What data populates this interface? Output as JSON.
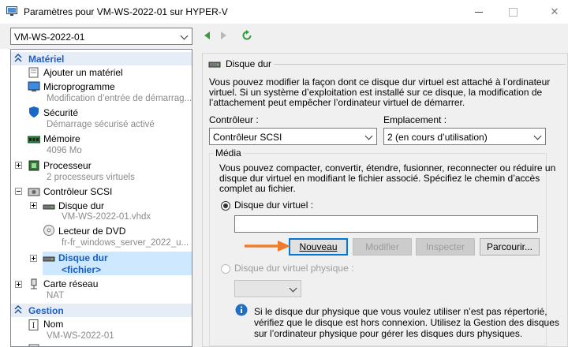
{
  "window": {
    "title": "Paramètres pour VM-WS-2022-01 sur HYPER-V",
    "close_glyph": "✕"
  },
  "toolbar": {
    "vm_selected": "VM-WS-2022-01"
  },
  "tree": {
    "materiel_header": "Matériel",
    "gestion_header": "Gestion",
    "add_hardware": "Ajouter un matériel",
    "firmware": {
      "label": "Microprogramme",
      "sub": "Modification d’entrée de démarrag..."
    },
    "security": {
      "label": "Sécurité",
      "sub": "Démarrage sécurisé activé"
    },
    "memory": {
      "label": "Mémoire",
      "sub": "4096 Mo"
    },
    "processor": {
      "label": "Processeur",
      "sub": "2 processeurs virtuels"
    },
    "scsi": {
      "label": "Contrôleur SCSI"
    },
    "hdd1": {
      "label": "Disque dur",
      "sub": "VM-WS-2022-01.vhdx"
    },
    "dvd": {
      "label": "Lecteur de DVD",
      "sub": "fr-fr_windows_server_2022_u..."
    },
    "hdd2": {
      "label": "Disque dur",
      "sub": "<fichier>"
    },
    "nic": {
      "label": "Carte réseau",
      "sub": "NAT"
    },
    "name": {
      "label": "Nom",
      "sub": "VM-WS-2022-01"
    }
  },
  "panel": {
    "title": "Disque dur",
    "description_lines": [
      "Vous pouvez modifier la façon dont ce disque dur virtuel est attaché à l’ordinateur",
      "virtuel. Si un système d’exploitation est installé sur ce disque, la modification de",
      "l’attachement peut empêcher l’ordinateur virtuel de démarrer."
    ],
    "controller_label": "Contrôleur :",
    "controller_value": "Contrôleur SCSI",
    "location_label": "Emplacement :",
    "location_value": "2 (en cours d’utilisation)",
    "media_label": "Média",
    "media_lines": [
      "Vous pouvez compacter, convertir, étendre, fusionner, reconnecter ou réduire un",
      "disque dur virtuel en modifiant le fichier associé. Spécifiez le chemin d’accès",
      "complet au fichier."
    ],
    "virtual_disk_label": "Disque dur virtuel :",
    "virtual_disk_path": "",
    "btn_new": "Nouveau",
    "btn_edit": "Modifier",
    "btn_inspect": "Inspecter",
    "btn_browse": "Parcourir...",
    "physical_disk_label": "Disque dur virtuel physique :",
    "physical_disk_value": "",
    "info_lines": [
      "Si le disque dur physique que vous voulez utiliser n’est pas répertorié,",
      "vérifiez que le disque est hors connexion. Utilisez la Gestion des disques",
      "sur l’ordinateur physique pour gérer les disques durs physiques."
    ]
  },
  "colors": {
    "accent": "#0078d7",
    "annotation_arrow": "#f07c2a",
    "selected": "#cde8ff"
  }
}
